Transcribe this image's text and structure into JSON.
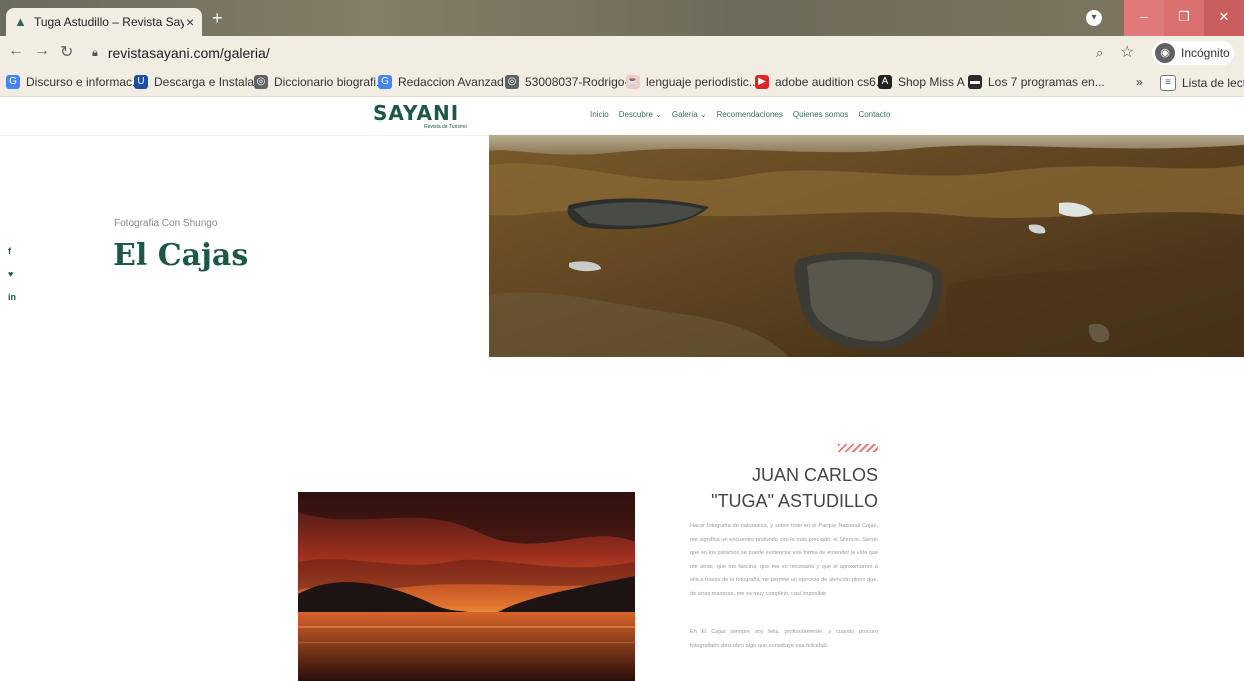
{
  "browser": {
    "tab_title": "Tuga Astudillo – Revista Sayani",
    "tab_close": "×",
    "new_tab": "+",
    "url": "revistasayani.com/galeria/",
    "profile_label": "Incógnito",
    "bookmarks": [
      {
        "label": "Discurso e informac...",
        "color": "#4285f4",
        "glyph": "G"
      },
      {
        "label": "Descarga e Instala...",
        "color": "#1d4fa3",
        "glyph": "U"
      },
      {
        "label": "Diccionario biografi...",
        "color": "#5f6368",
        "glyph": "◎"
      },
      {
        "label": "Redaccion Avanzad...",
        "color": "#4285f4",
        "glyph": "G"
      },
      {
        "label": "53008037-Rodrigo-...",
        "color": "#5f6368",
        "glyph": "◎"
      },
      {
        "label": "lenguaje periodistic...",
        "color": "#f3c9c2",
        "glyph": "☕"
      },
      {
        "label": "adobe audition cs6...",
        "color": "#e32222",
        "glyph": "▶"
      },
      {
        "label": "Shop Miss A",
        "color": "#222222",
        "glyph": "A"
      },
      {
        "label": "Los 7 programas en...",
        "color": "#2a2a2a",
        "glyph": "▬"
      }
    ],
    "bookmarks_overflow": "»",
    "reading_list": "Lista de lectur"
  },
  "site": {
    "logo": "SAYANI",
    "logo_tagline": "Revista de Turismo",
    "menu": [
      "Inicio",
      "Descubre ⌄",
      "Galeria ⌄",
      "Recomendaciones",
      "Quienes somos",
      "Contacto"
    ]
  },
  "hero": {
    "kicker": "Fotografia Con Shungo",
    "title": "El Cajas"
  },
  "social": [
    "f",
    "♥",
    "in"
  ],
  "article": {
    "author_line1": "JUAN CARLOS",
    "author_line2": "\"TUGA\" ASTUDILLO",
    "paragraph1": "Hacer fotografía de naturaleza, y sobre todo en el Parque Nacional Cajas, me significa un encuentro profundo con lo más preciado: el Silencio. Siento que en los páramos se puede evidenciar esa forma de entender la vida que me atrae, que me fascina; que me es necesario y que el aproximarme a ella a través de la fotografía me permite un ejercicio de atención pleno que, de otras maneras, me es muy complejo, casi imposible.",
    "paragraph2": "En El Cajas siempre soy feliz, profundamente, y cuando procuro fotografiarlo descubro algo que constituye esa felicidad."
  },
  "colors": {
    "brand": "#1e5748",
    "accent_stripes": "#e57e78"
  }
}
